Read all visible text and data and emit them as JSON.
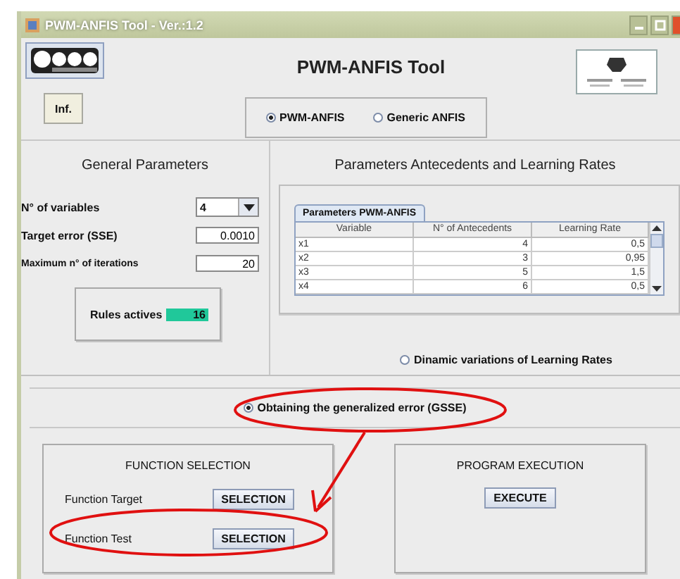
{
  "window": {
    "title": "PWM-ANFIS Tool - Ver.:1.2"
  },
  "header": {
    "title": "PWM-ANFIS Tool",
    "info_button": "Inf.",
    "modes": [
      {
        "label": "PWM-ANFIS",
        "selected": true
      },
      {
        "label": "Generic ANFIS",
        "selected": false
      }
    ]
  },
  "general": {
    "title": "General Parameters",
    "variables": {
      "label": "N° of variables",
      "value": "4"
    },
    "target_error": {
      "label": "Target error  (SSE)",
      "value": "0.0010"
    },
    "iterations": {
      "label": "Maximum n° of iterations",
      "value": "20"
    },
    "rules": {
      "label": "Rules actives",
      "value": "16"
    }
  },
  "antecedents": {
    "title": "Parameters Antecedents and Learning Rates",
    "tab": "Parameters PWM-ANFIS",
    "table": {
      "columns": [
        "Variable",
        "N° of Antecedents",
        "Learning Rate"
      ],
      "rows": [
        [
          "x1",
          "4",
          "0,5"
        ],
        [
          "x2",
          "3",
          "0,95"
        ],
        [
          "x3",
          "5",
          "1,5"
        ],
        [
          "x4",
          "6",
          "0,5"
        ]
      ]
    },
    "dynamic": {
      "label": "Dinamic variations of Learning Rates",
      "selected": false
    }
  },
  "gsse": {
    "label": "Obtaining the generalized error  (GSSE)",
    "selected": true
  },
  "function_selection": {
    "title": "FUNCTION SELECTION",
    "rows": [
      {
        "label": "Function Target",
        "button": "SELECTION"
      },
      {
        "label": "Function Test",
        "button": "SELECTION"
      }
    ]
  },
  "execution": {
    "title": "PROGRAM EXECUTION",
    "button": "EXECUTE"
  }
}
